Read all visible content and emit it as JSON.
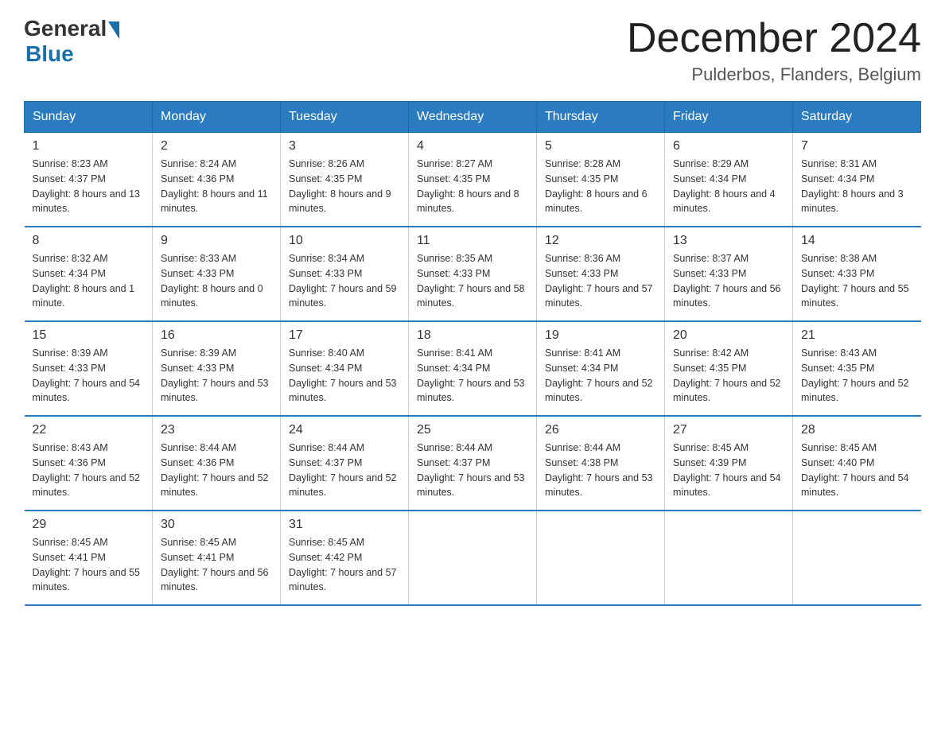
{
  "header": {
    "logo_general": "General",
    "logo_blue": "Blue",
    "month_title": "December 2024",
    "location": "Pulderbos, Flanders, Belgium"
  },
  "days_of_week": [
    "Sunday",
    "Monday",
    "Tuesday",
    "Wednesday",
    "Thursday",
    "Friday",
    "Saturday"
  ],
  "weeks": [
    [
      {
        "day": "1",
        "sunrise": "8:23 AM",
        "sunset": "4:37 PM",
        "daylight": "8 hours and 13 minutes."
      },
      {
        "day": "2",
        "sunrise": "8:24 AM",
        "sunset": "4:36 PM",
        "daylight": "8 hours and 11 minutes."
      },
      {
        "day": "3",
        "sunrise": "8:26 AM",
        "sunset": "4:35 PM",
        "daylight": "8 hours and 9 minutes."
      },
      {
        "day": "4",
        "sunrise": "8:27 AM",
        "sunset": "4:35 PM",
        "daylight": "8 hours and 8 minutes."
      },
      {
        "day": "5",
        "sunrise": "8:28 AM",
        "sunset": "4:35 PM",
        "daylight": "8 hours and 6 minutes."
      },
      {
        "day": "6",
        "sunrise": "8:29 AM",
        "sunset": "4:34 PM",
        "daylight": "8 hours and 4 minutes."
      },
      {
        "day": "7",
        "sunrise": "8:31 AM",
        "sunset": "4:34 PM",
        "daylight": "8 hours and 3 minutes."
      }
    ],
    [
      {
        "day": "8",
        "sunrise": "8:32 AM",
        "sunset": "4:34 PM",
        "daylight": "8 hours and 1 minute."
      },
      {
        "day": "9",
        "sunrise": "8:33 AM",
        "sunset": "4:33 PM",
        "daylight": "8 hours and 0 minutes."
      },
      {
        "day": "10",
        "sunrise": "8:34 AM",
        "sunset": "4:33 PM",
        "daylight": "7 hours and 59 minutes."
      },
      {
        "day": "11",
        "sunrise": "8:35 AM",
        "sunset": "4:33 PM",
        "daylight": "7 hours and 58 minutes."
      },
      {
        "day": "12",
        "sunrise": "8:36 AM",
        "sunset": "4:33 PM",
        "daylight": "7 hours and 57 minutes."
      },
      {
        "day": "13",
        "sunrise": "8:37 AM",
        "sunset": "4:33 PM",
        "daylight": "7 hours and 56 minutes."
      },
      {
        "day": "14",
        "sunrise": "8:38 AM",
        "sunset": "4:33 PM",
        "daylight": "7 hours and 55 minutes."
      }
    ],
    [
      {
        "day": "15",
        "sunrise": "8:39 AM",
        "sunset": "4:33 PM",
        "daylight": "7 hours and 54 minutes."
      },
      {
        "day": "16",
        "sunrise": "8:39 AM",
        "sunset": "4:33 PM",
        "daylight": "7 hours and 53 minutes."
      },
      {
        "day": "17",
        "sunrise": "8:40 AM",
        "sunset": "4:34 PM",
        "daylight": "7 hours and 53 minutes."
      },
      {
        "day": "18",
        "sunrise": "8:41 AM",
        "sunset": "4:34 PM",
        "daylight": "7 hours and 53 minutes."
      },
      {
        "day": "19",
        "sunrise": "8:41 AM",
        "sunset": "4:34 PM",
        "daylight": "7 hours and 52 minutes."
      },
      {
        "day": "20",
        "sunrise": "8:42 AM",
        "sunset": "4:35 PM",
        "daylight": "7 hours and 52 minutes."
      },
      {
        "day": "21",
        "sunrise": "8:43 AM",
        "sunset": "4:35 PM",
        "daylight": "7 hours and 52 minutes."
      }
    ],
    [
      {
        "day": "22",
        "sunrise": "8:43 AM",
        "sunset": "4:36 PM",
        "daylight": "7 hours and 52 minutes."
      },
      {
        "day": "23",
        "sunrise": "8:44 AM",
        "sunset": "4:36 PM",
        "daylight": "7 hours and 52 minutes."
      },
      {
        "day": "24",
        "sunrise": "8:44 AM",
        "sunset": "4:37 PM",
        "daylight": "7 hours and 52 minutes."
      },
      {
        "day": "25",
        "sunrise": "8:44 AM",
        "sunset": "4:37 PM",
        "daylight": "7 hours and 53 minutes."
      },
      {
        "day": "26",
        "sunrise": "8:44 AM",
        "sunset": "4:38 PM",
        "daylight": "7 hours and 53 minutes."
      },
      {
        "day": "27",
        "sunrise": "8:45 AM",
        "sunset": "4:39 PM",
        "daylight": "7 hours and 54 minutes."
      },
      {
        "day": "28",
        "sunrise": "8:45 AM",
        "sunset": "4:40 PM",
        "daylight": "7 hours and 54 minutes."
      }
    ],
    [
      {
        "day": "29",
        "sunrise": "8:45 AM",
        "sunset": "4:41 PM",
        "daylight": "7 hours and 55 minutes."
      },
      {
        "day": "30",
        "sunrise": "8:45 AM",
        "sunset": "4:41 PM",
        "daylight": "7 hours and 56 minutes."
      },
      {
        "day": "31",
        "sunrise": "8:45 AM",
        "sunset": "4:42 PM",
        "daylight": "7 hours and 57 minutes."
      },
      null,
      null,
      null,
      null
    ]
  ]
}
